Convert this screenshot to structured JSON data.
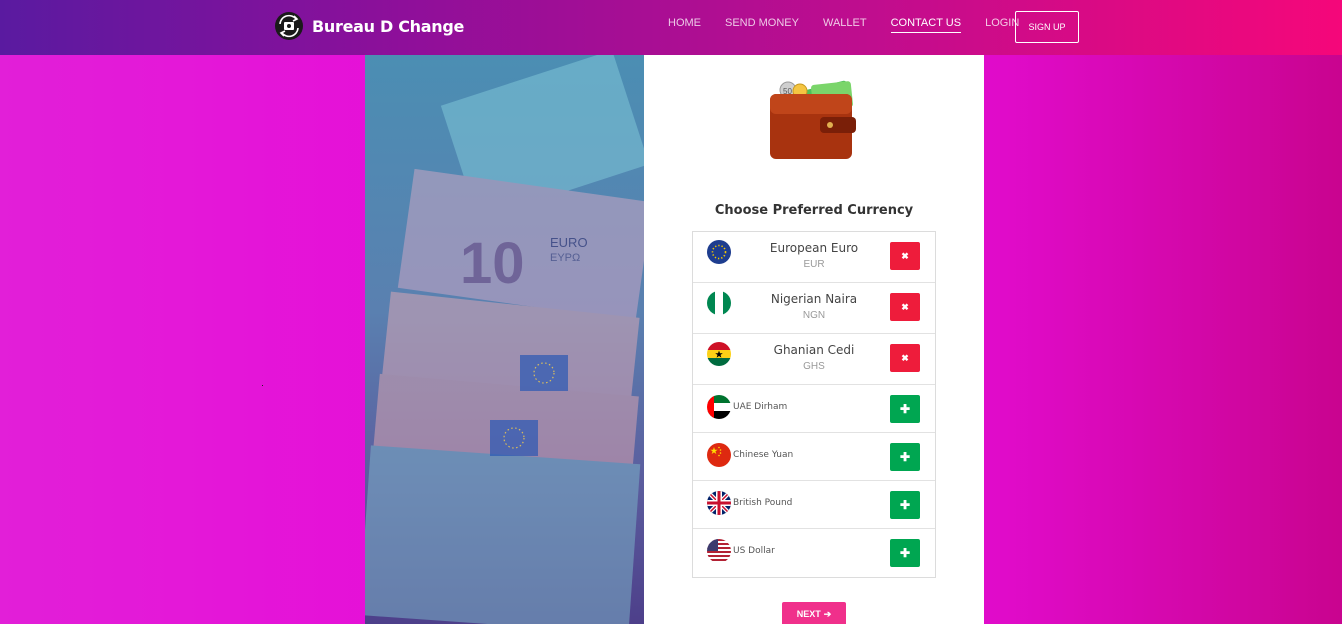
{
  "brand": {
    "name": "Bureau D Change",
    "icon": "currency-exchange-icon"
  },
  "nav": {
    "links": [
      {
        "label": "HOME",
        "active": false
      },
      {
        "label": "SEND MONEY",
        "active": false
      },
      {
        "label": "WALLET",
        "active": false
      },
      {
        "label": "CONTACT US",
        "active": true
      },
      {
        "label": "LOGIN",
        "active": false
      }
    ],
    "signup_label": "SIGN UP"
  },
  "photo": {
    "banknote_labels": [
      "EURO",
      "ΕΥΡΩ",
      "10"
    ]
  },
  "card": {
    "wallet_icon": "wallet-icon",
    "coin_label": "50",
    "title": "Choose Preferred Currency",
    "currencies": [
      {
        "name": "European Euro",
        "code": "EUR",
        "flag": "eu-flag-icon",
        "selected": true
      },
      {
        "name": "Nigerian Naira",
        "code": "NGN",
        "flag": "nigeria-flag-icon",
        "selected": true
      },
      {
        "name": "Ghanian Cedi",
        "code": "GHS",
        "flag": "ghana-flag-icon",
        "selected": true
      },
      {
        "name": "UAE Dirham",
        "flag": "uae-flag-icon",
        "selected": false
      },
      {
        "name": "Chinese Yuan",
        "flag": "china-flag-icon",
        "selected": false
      },
      {
        "name": "British Pound",
        "flag": "uk-flag-icon",
        "selected": false
      },
      {
        "name": "US Dollar",
        "flag": "us-flag-icon",
        "selected": false
      }
    ],
    "remove_icon": "✖",
    "add_icon": "✚",
    "next_label": "NEXT",
    "next_icon": "➔"
  },
  "colors": {
    "accent": "#f0308b",
    "remove": "#ee1c3b",
    "add": "#00a651"
  }
}
